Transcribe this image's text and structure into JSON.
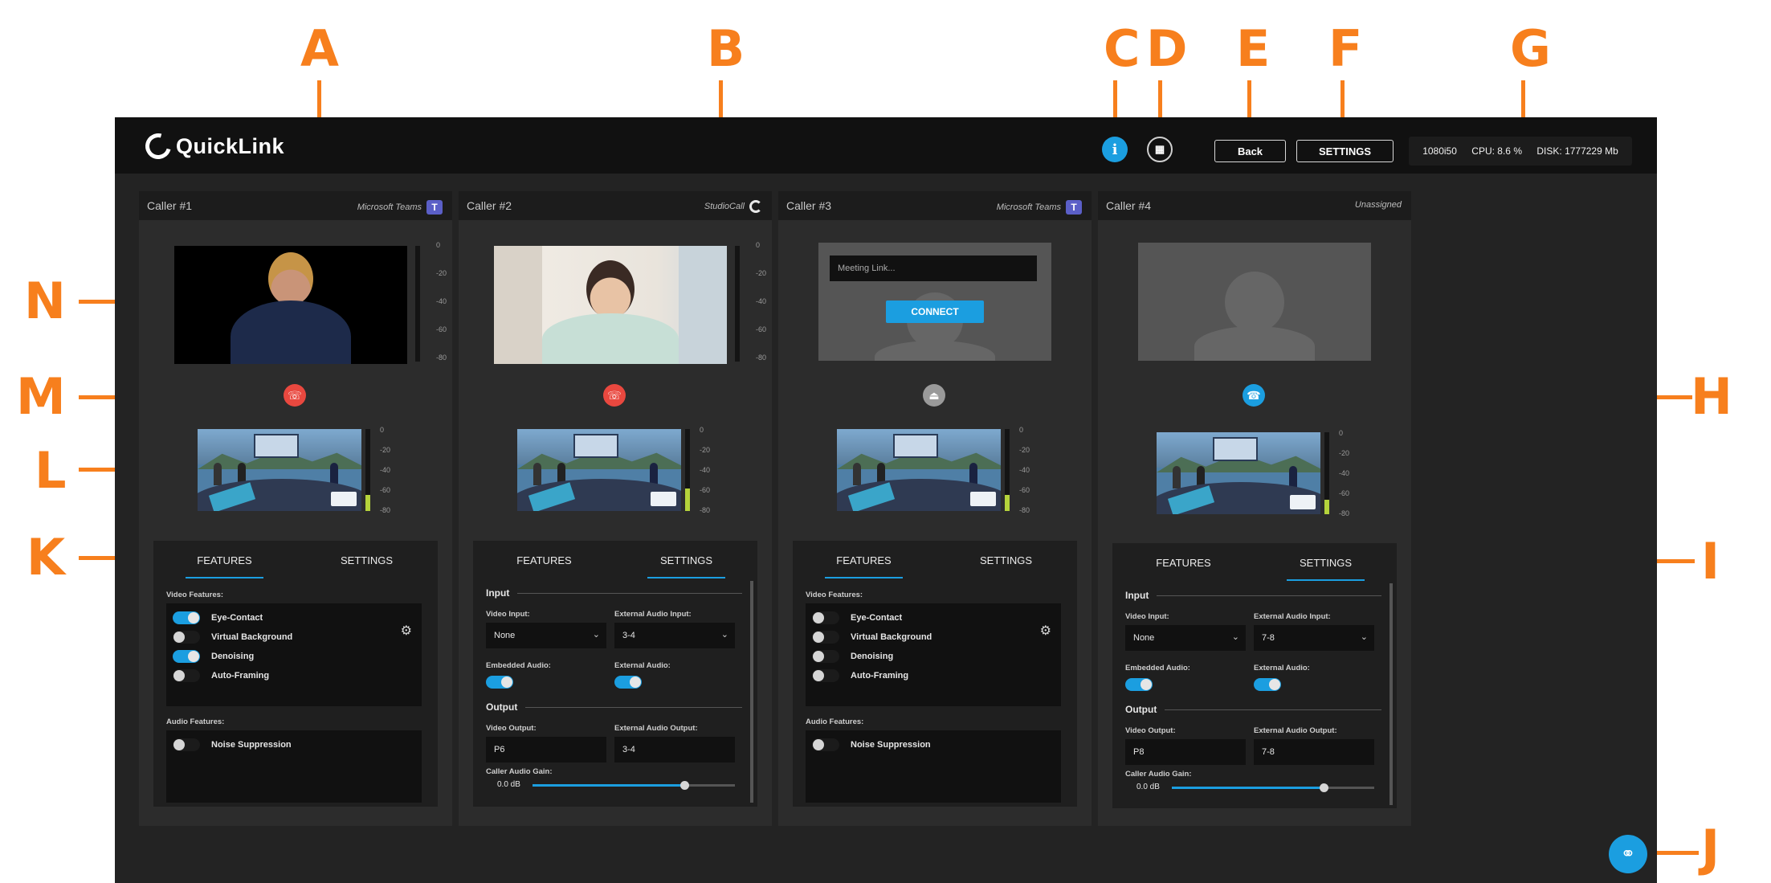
{
  "annotations": [
    "A",
    "B",
    "C",
    "D",
    "E",
    "F",
    "G",
    "H",
    "I",
    "J",
    "K",
    "L",
    "M",
    "N"
  ],
  "app": {
    "logo_text": "QuickLink",
    "info_icon": "i",
    "back_label": "Back",
    "settings_label": "SETTINGS",
    "stats": {
      "resolution": "1080i50",
      "cpu": "CPU: 8.6 %",
      "disk": "DISK: 1777229 Mb"
    }
  },
  "meter_ticks": [
    "0",
    "-20",
    "-40",
    "-60",
    "-80"
  ],
  "callers": [
    {
      "name": "Caller #1",
      "platform": "Microsoft Teams",
      "platform_icon": "teams-icon",
      "call_state": "hangup",
      "tabs": [
        "FEATURES",
        "SETTINGS"
      ],
      "active_tab": "FEATURES",
      "video_features_label": "Video Features:",
      "video_features": [
        {
          "label": "Eye-Contact",
          "on": true
        },
        {
          "label": "Virtual Background",
          "on": false
        },
        {
          "label": "Denoising",
          "on": true
        },
        {
          "label": "Auto-Framing",
          "on": false
        }
      ],
      "audio_features_label": "Audio Features:",
      "audio_features": [
        {
          "label": "Noise Suppression",
          "on": false
        }
      ]
    },
    {
      "name": "Caller #2",
      "platform": "StudioCall",
      "platform_icon": "studiocall-icon",
      "call_state": "hangup",
      "tabs": [
        "FEATURES",
        "SETTINGS"
      ],
      "active_tab": "SETTINGS",
      "settings": {
        "input_heading": "Input",
        "video_input_label": "Video Input:",
        "video_input": "None",
        "ext_audio_input_label": "External Audio Input:",
        "ext_audio_input": "3-4",
        "embedded_audio_label": "Embedded Audio:",
        "embedded_audio_on": true,
        "external_audio_label": "External Audio:",
        "external_audio_on": true,
        "output_heading": "Output",
        "video_output_label": "Video Output:",
        "video_output": "P6",
        "ext_audio_output_label": "External Audio Output:",
        "ext_audio_output": "3-4",
        "gain_label": "Caller Audio Gain:",
        "gain_value": "0.0 dB",
        "gain_level": 0.75
      }
    },
    {
      "name": "Caller #3",
      "platform": "Microsoft Teams",
      "platform_icon": "teams-icon",
      "call_state": "eject",
      "meeting_placeholder": "Meeting Link...",
      "connect_label": "CONNECT",
      "tabs": [
        "FEATURES",
        "SETTINGS"
      ],
      "active_tab": "FEATURES",
      "video_features_label": "Video Features:",
      "video_features": [
        {
          "label": "Eye-Contact",
          "on": false
        },
        {
          "label": "Virtual Background",
          "on": false
        },
        {
          "label": "Denoising",
          "on": false
        },
        {
          "label": "Auto-Framing",
          "on": false
        }
      ],
      "audio_features_label": "Audio Features:",
      "audio_features": [
        {
          "label": "Noise Suppression",
          "on": false
        }
      ]
    },
    {
      "name": "Caller #4",
      "platform": "Unassigned",
      "call_state": "dial",
      "tabs": [
        "FEATURES",
        "SETTINGS"
      ],
      "active_tab": "SETTINGS",
      "settings": {
        "input_heading": "Input",
        "video_input_label": "Video Input:",
        "video_input": "None",
        "ext_audio_input_label": "External Audio Input:",
        "ext_audio_input": "7-8",
        "embedded_audio_label": "Embedded Audio:",
        "embedded_audio_on": true,
        "external_audio_label": "External Audio:",
        "external_audio_on": true,
        "output_heading": "Output",
        "video_output_label": "Video Output:",
        "video_output": "P8",
        "ext_audio_output_label": "External Audio Output:",
        "ext_audio_output": "7-8",
        "gain_label": "Caller Audio Gain:",
        "gain_value": "0.0 dB",
        "gain_level": 0.75
      }
    }
  ],
  "colors": {
    "accent": "#1b9ee0",
    "hangup": "#e9483f",
    "annotation": "#F77F1D",
    "meter": "#b5d33b"
  }
}
